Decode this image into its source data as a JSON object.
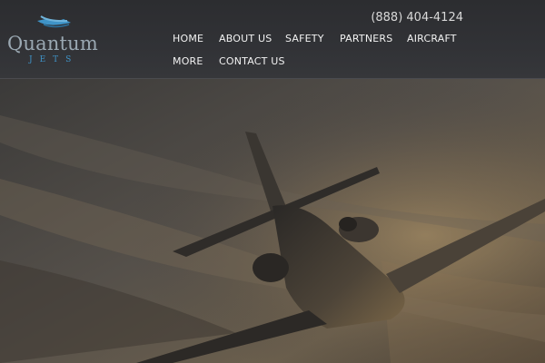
{
  "brand": {
    "name": "Quantum",
    "sub": "JETS"
  },
  "header": {
    "phone": "(888) 404-4124"
  },
  "nav": {
    "items": [
      {
        "label": "HOME"
      },
      {
        "label": "ABOUT US"
      },
      {
        "label": "SAFETY"
      },
      {
        "label": "PARTNERS"
      },
      {
        "label": "AIRCRAFT"
      },
      {
        "label": "MORE"
      },
      {
        "label": "CONTACT US"
      }
    ]
  },
  "hero": {
    "image": "private-jet-banking-above-clouds-at-sunset"
  },
  "colors": {
    "header_bg": "#313236",
    "logo_blue": "#3f94c8",
    "logo_gray": "#9aa8b2",
    "nav_text": "#f2f2f2"
  }
}
